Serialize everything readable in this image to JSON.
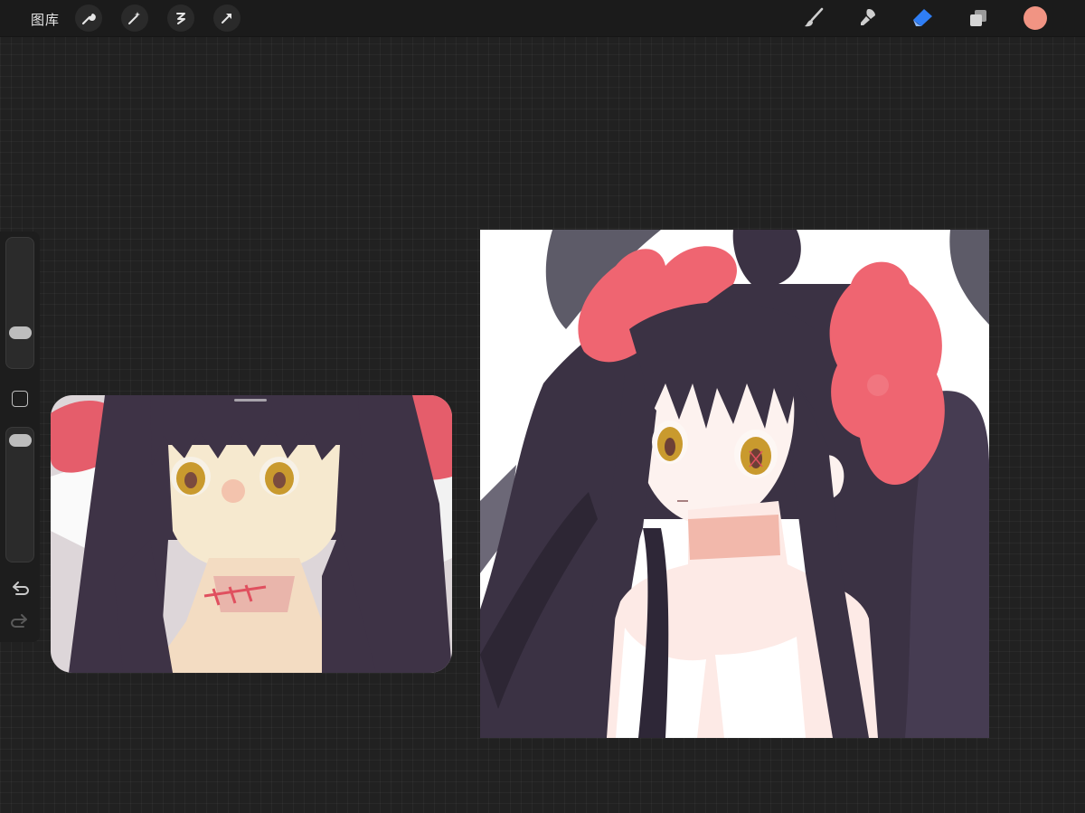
{
  "toolbar": {
    "gallery_label": "图库",
    "left_tools": [
      "wrench-icon",
      "magic-wand-icon",
      "selection-icon",
      "transform-arrow-icon"
    ],
    "right_tools": [
      "brush-icon",
      "smudge-icon",
      "eraser-icon",
      "layers-icon"
    ],
    "active_tool": "eraser-icon",
    "active_color": "#f19483",
    "accent_color": "#2f7ef6"
  },
  "sidebar": {
    "brush_size_level": 0.25,
    "opacity_level": 0.97
  },
  "reference_window": {
    "description_visible": false
  },
  "colors": {
    "hair": "#3b3244",
    "flower": "#ef6571",
    "skin": "#fde9e4",
    "eyes": "#c99a2e"
  }
}
